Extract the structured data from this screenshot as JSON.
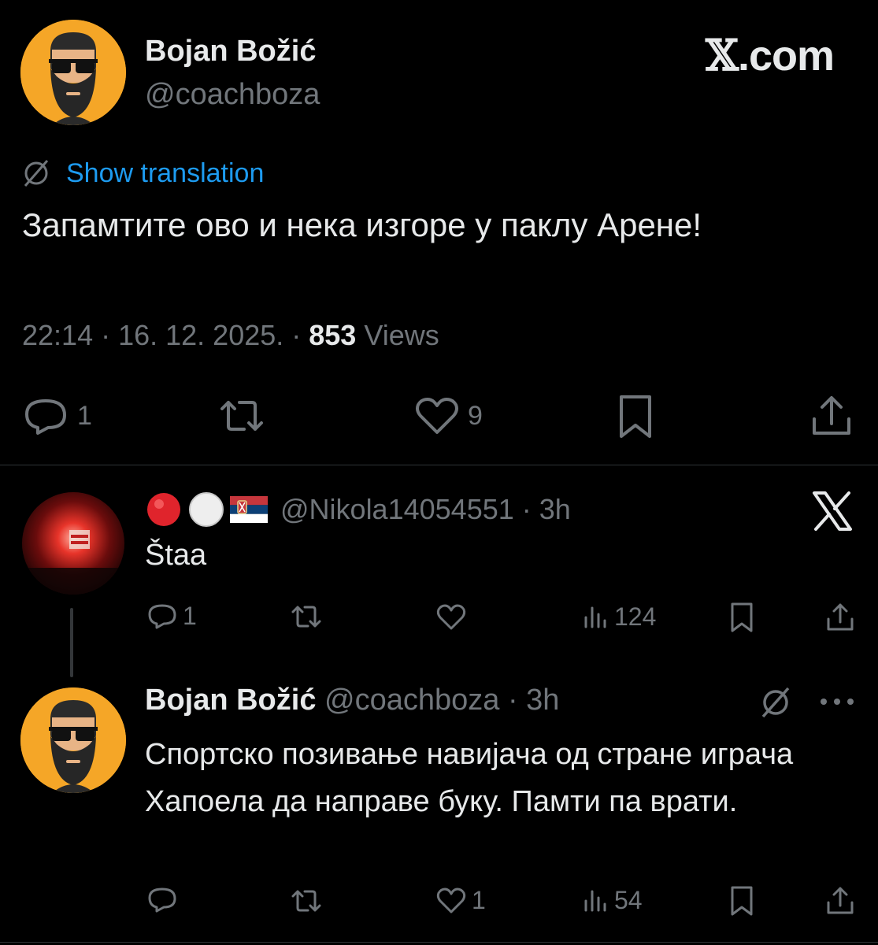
{
  "brand": {
    "prefix": "𝕏",
    "suffix": ".com"
  },
  "main_tweet": {
    "author_name": "Bojan Božić",
    "author_handle": "@coachboza",
    "translate_label": "Show translation",
    "text": "Запамтите ово и нека изгоре у паклу Арене!",
    "time": "22:14 · 16. 12. 2025. · ",
    "views_count": "853",
    "views_label": " Views",
    "actions": {
      "replies": "1",
      "likes": "9"
    }
  },
  "reply_1": {
    "handle_time": "@Nikola14054551 · 3h",
    "text": "Štaa",
    "actions": {
      "replies": "1",
      "views": "124"
    }
  },
  "reply_2": {
    "author_name": "Bojan Božić",
    "handle_time": " @coachboza · 3h",
    "text": "Спортско позивање навијача од стране играча Хапоела да направе буку. Памти па врати.",
    "actions": {
      "likes": "1",
      "views": "54"
    }
  },
  "colors": {
    "accent": "#1d9bf0",
    "muted": "#71767b",
    "text": "#e7e9ea",
    "avatar_bg": "#f5a627"
  }
}
